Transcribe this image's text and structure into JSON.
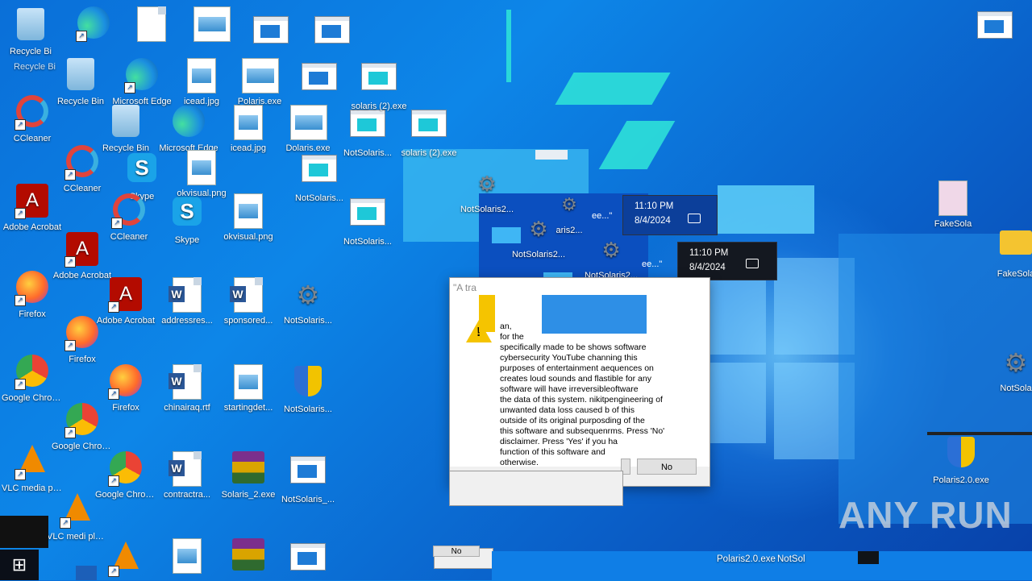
{
  "desktop_icons": [
    {
      "label": "Recycle Bi",
      "type": "bin"
    },
    {
      "label": "Recycle Bi",
      "type": "bin"
    },
    {
      "label": "Recycle Bin",
      "type": "bin"
    },
    {
      "label": "Recycle Bin",
      "type": "bin"
    },
    {
      "label": "CCleaner",
      "type": "ccl"
    },
    {
      "label": "CCleaner",
      "type": "ccl"
    },
    {
      "label": "CCleaner",
      "type": "ccl"
    },
    {
      "label": "Adobe Acrobat",
      "type": "pdf"
    },
    {
      "label": "Adobe Acrobat",
      "type": "pdf"
    },
    {
      "label": "Adobe Acrobat",
      "type": "pdf"
    },
    {
      "label": "Firefox",
      "type": "firefox"
    },
    {
      "label": "Firefox",
      "type": "firefox"
    },
    {
      "label": "Firefox",
      "type": "firefox"
    },
    {
      "label": "Google Chrome",
      "type": "chrome"
    },
    {
      "label": "Google Chrome",
      "type": "chrome"
    },
    {
      "label": "Google Chrome",
      "type": "chrome"
    },
    {
      "label": "VLC media player",
      "type": "vlc"
    },
    {
      "label": "VLC medi player",
      "type": "vlc"
    },
    {
      "label": "Microsoft Edge",
      "type": "edge"
    },
    {
      "label": "Microsoft Edge",
      "type": "edge"
    },
    {
      "label": "Microsoft Edge",
      "type": "edge"
    },
    {
      "label": "Skype",
      "type": "sky"
    },
    {
      "label": "Skype",
      "type": "sky"
    },
    {
      "label": "CCleaner",
      "type": "ccl"
    },
    {
      "label": "icead.jpg",
      "type": "img"
    },
    {
      "label": "icead.jpg",
      "type": "img"
    },
    {
      "label": "okvisual.png",
      "type": "img"
    },
    {
      "label": "okvisual.png",
      "type": "img"
    },
    {
      "label": "addressres...",
      "type": "word"
    },
    {
      "label": "chinairaq.rtf",
      "type": "word"
    },
    {
      "label": "contractra...",
      "type": "word"
    },
    {
      "label": "sponsored...",
      "type": "word"
    },
    {
      "label": "startingdet...",
      "type": "img"
    },
    {
      "label": "Solaris_2.exe",
      "type": "rar"
    },
    {
      "label": "Polaris.exe",
      "type": "img"
    },
    {
      "label": "Dolaris.exe",
      "type": "img"
    },
    {
      "label": "NotSolaris...",
      "type": "win"
    },
    {
      "label": "NotSolaris...",
      "type": "win"
    },
    {
      "label": "NotSolaris...",
      "type": "win"
    },
    {
      "label": "NotSolaris...",
      "type": "gear"
    },
    {
      "label": "NotSolaris...",
      "type": "shield"
    },
    {
      "label": "NotSolaris_...",
      "type": "win"
    },
    {
      "label": "solaris (2).exe",
      "type": "win"
    },
    {
      "label": "solaris (2).exe",
      "type": "win"
    },
    {
      "label": "FakeSola",
      "type": "file"
    },
    {
      "label": "FakeSola",
      "type": "folder"
    },
    {
      "label": "NotSola",
      "type": "gear"
    },
    {
      "label": "Polaris2.0.exe",
      "type": "shield"
    }
  ],
  "glitch_windows": [
    {
      "label": "NotSolaris2..."
    },
    {
      "label": "NotSolaris2..."
    },
    {
      "label": "NotSolaris2..."
    },
    {
      "label": "aris2..."
    }
  ],
  "clock_flyouts": [
    {
      "time": "11:10 PM",
      "date": "8/4/2024"
    },
    {
      "time": "11:10 PM",
      "date": "8/4/2024"
    }
  ],
  "dialog": {
    "title": "\"A tra",
    "lines": [
      "                                     an,",
      "                                      for the",
      "specifically made to be shows software",
      "cybersecurity YouTube channing this",
      "purposes of entertainment aequences on",
      "creates loud sounds and flastible for any",
      "software will have irreversibleoftware",
      "the data of this system. nikitpengineering of",
      "unwanted data loss caused b of this",
      "outside of its original purposding of the",
      "this software and subsequenrms. Press 'No'",
      "disclaimer. Press 'Yes' if you ha",
      "function of this software and",
      "otherwise."
    ],
    "fragment_partial_1": "\"A tra",
    "fragment_partial_2": "ee...\"",
    "fragment_partial_3": "ee...\"",
    "no_button": "No",
    "no_button_ghost": "No"
  },
  "taskbar": {
    "bottom_labels": [
      "Polaris2.0.exe",
      "NotSol"
    ],
    "start_icon": "windows-logo"
  },
  "watermark": "ANY RUN"
}
